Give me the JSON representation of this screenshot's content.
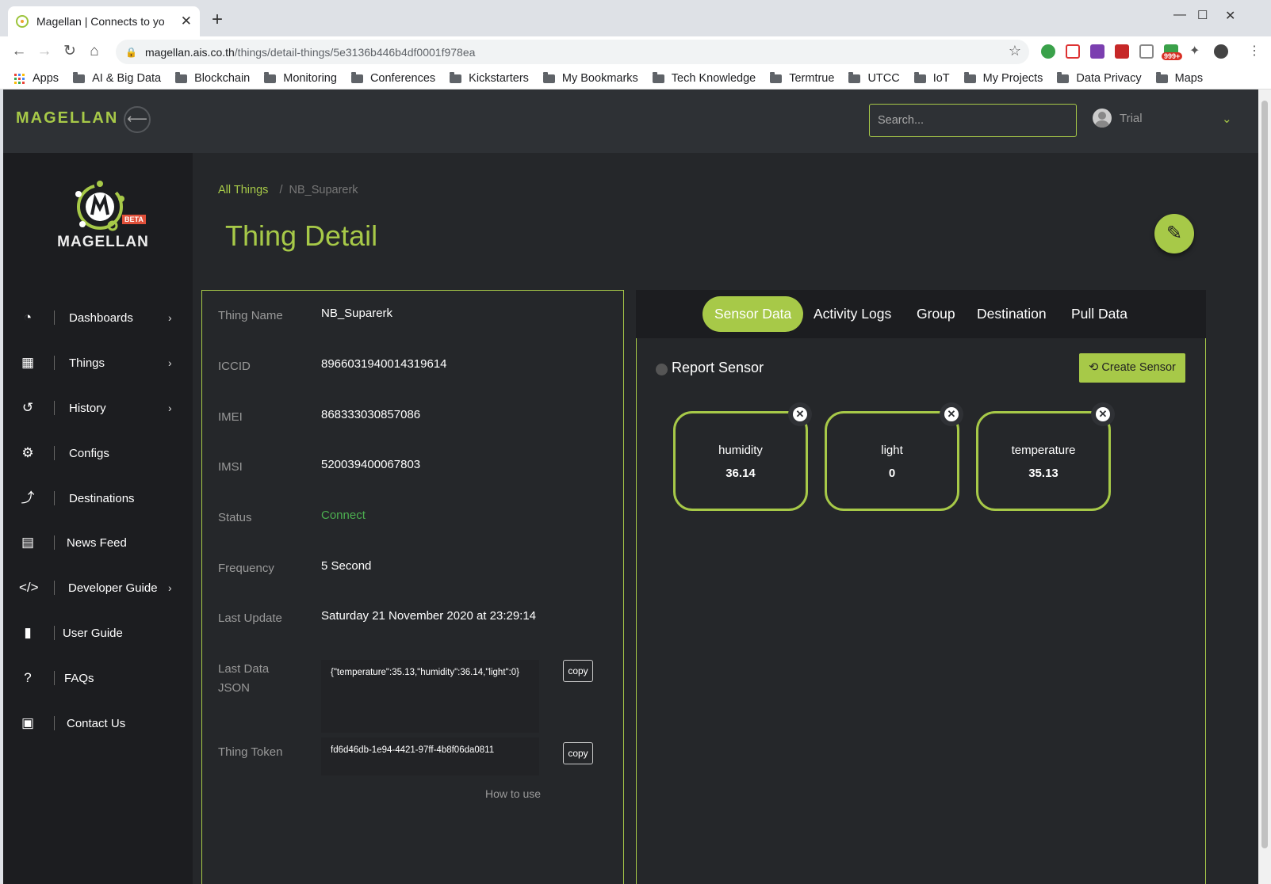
{
  "browser": {
    "tab_title": "Magellan | Connects to yo",
    "url_host": "magellan.ais.co.th",
    "url_path": "/things/detail-things/5e3136b446b4df0001f978ea",
    "ext_badge": "999+",
    "bookmarks": [
      "Apps",
      "AI & Big Data",
      "Blockchain",
      "Monitoring",
      "Conferences",
      "Kickstarters",
      "My Bookmarks",
      "Tech Knowledge",
      "Termtrue",
      "UTCC",
      "IoT",
      "My Projects",
      "Data Privacy",
      "Maps"
    ]
  },
  "header": {
    "brand": "MAGELLAN",
    "search_placeholder": "Search...",
    "user": "Trial"
  },
  "sidebar": {
    "logo_text": "MAGELLAN",
    "logo_badge": "BETA",
    "items": [
      {
        "label": "Dashboards",
        "icon": "dashboard-icon",
        "arrow": true
      },
      {
        "label": "Things",
        "icon": "chip-icon",
        "arrow": true
      },
      {
        "label": "History",
        "icon": "history-icon",
        "arrow": true
      },
      {
        "label": "Configs",
        "icon": "gears-icon",
        "arrow": false
      },
      {
        "label": "Destinations",
        "icon": "route-icon",
        "arrow": false
      },
      {
        "label": "News Feed",
        "icon": "newspaper-icon",
        "arrow": false
      },
      {
        "label": "Developer Guide",
        "icon": "code-icon",
        "arrow": true
      },
      {
        "label": "User Guide",
        "icon": "book-icon",
        "arrow": false
      },
      {
        "label": "FAQs",
        "icon": "question-icon",
        "arrow": false
      },
      {
        "label": "Contact Us",
        "icon": "contact-card-icon",
        "arrow": false
      }
    ]
  },
  "breadcrumb": {
    "parent": "All Things",
    "sep": "/",
    "current": "NB_Suparerk"
  },
  "page_title": "Thing Detail",
  "detail": {
    "thing_name_label": "Thing Name",
    "thing_name": "NB_Suparerk",
    "iccid_label": "ICCID",
    "iccid": "8966031940014319614",
    "imei_label": "IMEI",
    "imei": "868333030857086",
    "imsi_label": "IMSI",
    "imsi": "520039400067803",
    "status_label": "Status",
    "status": "Connect",
    "frequency_label": "Frequency",
    "frequency": "5 Second",
    "last_update_label": "Last Update",
    "last_update": "Saturday 21 November 2020 at 23:29:14",
    "last_data_label_1": "Last Data",
    "last_data_label_2": "JSON",
    "last_data": "{\"temperature\":35.13,\"humidity\":36.14,\"light\":0}",
    "token_label": "Thing Token",
    "token": "fd6d46db-1e94-4421-97ff-4b8f06da0811",
    "copy_label": "copy",
    "how_to_use": "How to use"
  },
  "tabs": [
    "Sensor Data",
    "Activity Logs",
    "Group",
    "Destination",
    "Pull Data"
  ],
  "sensor_panel": {
    "title": "Report Sensor",
    "create_label": "Create Sensor",
    "sensors": [
      {
        "name": "humidity",
        "value": "36.14"
      },
      {
        "name": "light",
        "value": "0"
      },
      {
        "name": "temperature",
        "value": "35.13"
      }
    ]
  },
  "colors": {
    "accent": "#a7c948",
    "status_ok": "#4caf50",
    "background": "#25272a",
    "sidebar": "#1c1d20"
  }
}
